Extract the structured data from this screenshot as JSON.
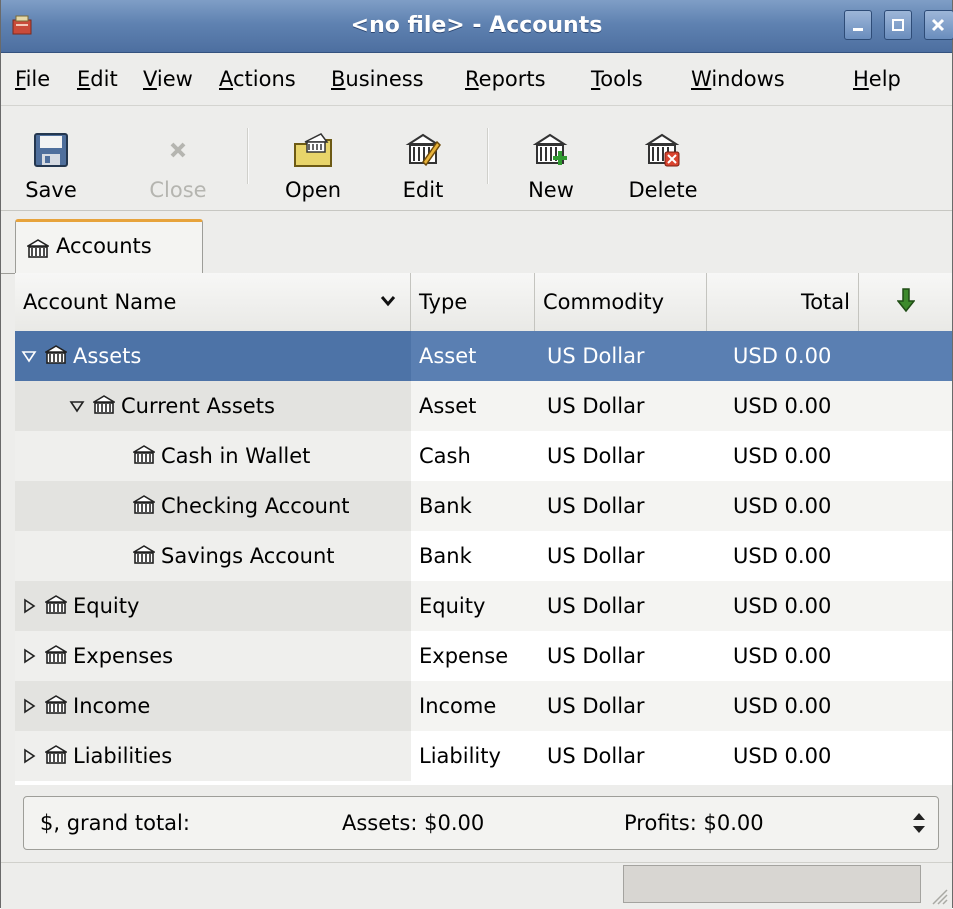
{
  "window": {
    "title": "<no file> - Accounts"
  },
  "menu": [
    {
      "mnemonic": "F",
      "rest": "ile"
    },
    {
      "mnemonic": "E",
      "rest": "dit"
    },
    {
      "mnemonic": "V",
      "rest": "iew"
    },
    {
      "mnemonic": "A",
      "rest": "ctions"
    },
    {
      "mnemonic": "B",
      "rest": "usiness"
    },
    {
      "mnemonic": "R",
      "rest": "eports"
    },
    {
      "mnemonic": "T",
      "rest": "ools"
    },
    {
      "mnemonic": "W",
      "rest": "indows"
    },
    {
      "mnemonic": "H",
      "rest": "elp"
    }
  ],
  "toolbar": {
    "save": "Save",
    "close": "Close",
    "open": "Open",
    "edit": "Edit",
    "new": "New",
    "delete": "Delete"
  },
  "tabs": [
    {
      "label": "Accounts"
    }
  ],
  "columns": {
    "name": "Account Name",
    "type": "Type",
    "commodity": "Commodity",
    "total": "Total"
  },
  "accounts": [
    {
      "name": "Assets",
      "type": "Asset",
      "commodity": "US Dollar",
      "total": "USD 0.00"
    },
    {
      "name": "Current Assets",
      "type": "Asset",
      "commodity": "US Dollar",
      "total": "USD 0.00"
    },
    {
      "name": "Cash in Wallet",
      "type": "Cash",
      "commodity": "US Dollar",
      "total": "USD 0.00"
    },
    {
      "name": "Checking Account",
      "type": "Bank",
      "commodity": "US Dollar",
      "total": "USD 0.00"
    },
    {
      "name": "Savings Account",
      "type": "Bank",
      "commodity": "US Dollar",
      "total": "USD 0.00"
    },
    {
      "name": "Equity",
      "type": "Equity",
      "commodity": "US Dollar",
      "total": "USD 0.00"
    },
    {
      "name": "Expenses",
      "type": "Expense",
      "commodity": "US Dollar",
      "total": "USD 0.00"
    },
    {
      "name": "Income",
      "type": "Income",
      "commodity": "US Dollar",
      "total": "USD 0.00"
    },
    {
      "name": "Liabilities",
      "type": "Liability",
      "commodity": "US Dollar",
      "total": "USD 0.00"
    }
  ],
  "summary": {
    "label": "$, grand total:",
    "assets": "Assets: $0.00",
    "profits": "Profits: $0.00"
  },
  "colors": {
    "selection": "#5a7fb2",
    "titlebar": "#5f82b1",
    "tab_accent": "#e7a33c"
  },
  "icons": {
    "account": "bank-building-icon",
    "expander_open": "triangle-down-icon",
    "expander_closed": "triangle-right-icon"
  }
}
